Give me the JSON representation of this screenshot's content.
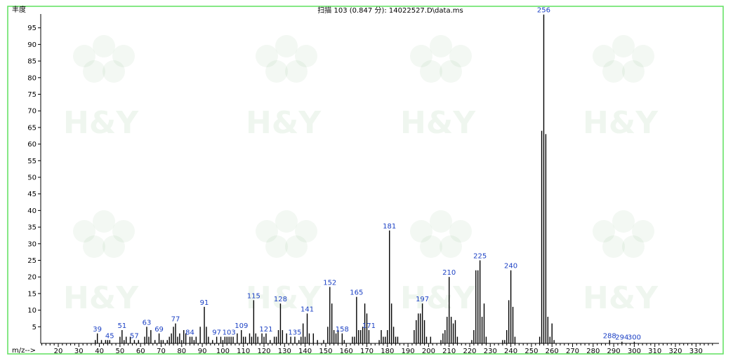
{
  "chart_data": {
    "type": "bar",
    "title": "扫描 103 (0.847 分): 14022527.D\\data.ms",
    "ylabel": "丰度",
    "xlabel": "m/z-->",
    "xlim": [
      10,
      340
    ],
    "ylim": [
      0,
      100
    ],
    "x_ticks": [
      20,
      30,
      40,
      50,
      60,
      70,
      80,
      90,
      100,
      110,
      120,
      130,
      140,
      150,
      160,
      170,
      180,
      190,
      200,
      210,
      220,
      230,
      240,
      250,
      260,
      270,
      280,
      290,
      300,
      310,
      320,
      330
    ],
    "y_ticks": [
      5,
      10,
      15,
      20,
      25,
      30,
      35,
      40,
      45,
      50,
      55,
      60,
      65,
      70,
      75,
      80,
      85,
      90,
      95
    ],
    "peaks": [
      {
        "mz": 38,
        "y": 1
      },
      {
        "mz": 39,
        "y": 3
      },
      {
        "mz": 41,
        "y": 1
      },
      {
        "mz": 43,
        "y": 1
      },
      {
        "mz": 44,
        "y": 1
      },
      {
        "mz": 45,
        "y": 1
      },
      {
        "mz": 50,
        "y": 2
      },
      {
        "mz": 51,
        "y": 4
      },
      {
        "mz": 52,
        "y": 1
      },
      {
        "mz": 53,
        "y": 2
      },
      {
        "mz": 55,
        "y": 2
      },
      {
        "mz": 57,
        "y": 1
      },
      {
        "mz": 59,
        "y": 1
      },
      {
        "mz": 62,
        "y": 2
      },
      {
        "mz": 63,
        "y": 5
      },
      {
        "mz": 64,
        "y": 2
      },
      {
        "mz": 65,
        "y": 4
      },
      {
        "mz": 67,
        "y": 1
      },
      {
        "mz": 69,
        "y": 3
      },
      {
        "mz": 70,
        "y": 1
      },
      {
        "mz": 71,
        "y": 1
      },
      {
        "mz": 73,
        "y": 1
      },
      {
        "mz": 74,
        "y": 2
      },
      {
        "mz": 75,
        "y": 3
      },
      {
        "mz": 76,
        "y": 5
      },
      {
        "mz": 77,
        "y": 6
      },
      {
        "mz": 78,
        "y": 2
      },
      {
        "mz": 79,
        "y": 3
      },
      {
        "mz": 80,
        "y": 1
      },
      {
        "mz": 81,
        "y": 4
      },
      {
        "mz": 82,
        "y": 3
      },
      {
        "mz": 84,
        "y": 2
      },
      {
        "mz": 85,
        "y": 2
      },
      {
        "mz": 86,
        "y": 1
      },
      {
        "mz": 87,
        "y": 2
      },
      {
        "mz": 89,
        "y": 5
      },
      {
        "mz": 91,
        "y": 11
      },
      {
        "mz": 92,
        "y": 5
      },
      {
        "mz": 93,
        "y": 2
      },
      {
        "mz": 95,
        "y": 1
      },
      {
        "mz": 97,
        "y": 2
      },
      {
        "mz": 99,
        "y": 2
      },
      {
        "mz": 100,
        "y": 1
      },
      {
        "mz": 101,
        "y": 2
      },
      {
        "mz": 102,
        "y": 2
      },
      {
        "mz": 103,
        "y": 2
      },
      {
        "mz": 104,
        "y": 2
      },
      {
        "mz": 105,
        "y": 2
      },
      {
        "mz": 107,
        "y": 3
      },
      {
        "mz": 109,
        "y": 4
      },
      {
        "mz": 110,
        "y": 2
      },
      {
        "mz": 111,
        "y": 2
      },
      {
        "mz": 113,
        "y": 3
      },
      {
        "mz": 114,
        "y": 2
      },
      {
        "mz": 115,
        "y": 13
      },
      {
        "mz": 116,
        "y": 3
      },
      {
        "mz": 117,
        "y": 2
      },
      {
        "mz": 119,
        "y": 3
      },
      {
        "mz": 120,
        "y": 2
      },
      {
        "mz": 121,
        "y": 3
      },
      {
        "mz": 123,
        "y": 1
      },
      {
        "mz": 125,
        "y": 2
      },
      {
        "mz": 126,
        "y": 2
      },
      {
        "mz": 127,
        "y": 4
      },
      {
        "mz": 128,
        "y": 12
      },
      {
        "mz": 129,
        "y": 4
      },
      {
        "mz": 131,
        "y": 3
      },
      {
        "mz": 133,
        "y": 2
      },
      {
        "mz": 135,
        "y": 2
      },
      {
        "mz": 137,
        "y": 1
      },
      {
        "mz": 138,
        "y": 2
      },
      {
        "mz": 139,
        "y": 6
      },
      {
        "mz": 140,
        "y": 2
      },
      {
        "mz": 141,
        "y": 9
      },
      {
        "mz": 142,
        "y": 3
      },
      {
        "mz": 144,
        "y": 3
      },
      {
        "mz": 146,
        "y": 1
      },
      {
        "mz": 149,
        "y": 1
      },
      {
        "mz": 151,
        "y": 5
      },
      {
        "mz": 152,
        "y": 17
      },
      {
        "mz": 153,
        "y": 12
      },
      {
        "mz": 154,
        "y": 4
      },
      {
        "mz": 155,
        "y": 3
      },
      {
        "mz": 156,
        "y": 4
      },
      {
        "mz": 158,
        "y": 3
      },
      {
        "mz": 159,
        "y": 1
      },
      {
        "mz": 163,
        "y": 2
      },
      {
        "mz": 164,
        "y": 2
      },
      {
        "mz": 165,
        "y": 14
      },
      {
        "mz": 166,
        "y": 4
      },
      {
        "mz": 167,
        "y": 4
      },
      {
        "mz": 168,
        "y": 5
      },
      {
        "mz": 169,
        "y": 12
      },
      {
        "mz": 170,
        "y": 9
      },
      {
        "mz": 171,
        "y": 4
      },
      {
        "mz": 176,
        "y": 1
      },
      {
        "mz": 177,
        "y": 4
      },
      {
        "mz": 178,
        "y": 2
      },
      {
        "mz": 179,
        "y": 2
      },
      {
        "mz": 180,
        "y": 4
      },
      {
        "mz": 181,
        "y": 34
      },
      {
        "mz": 182,
        "y": 12
      },
      {
        "mz": 183,
        "y": 5
      },
      {
        "mz": 184,
        "y": 2
      },
      {
        "mz": 185,
        "y": 2
      },
      {
        "mz": 193,
        "y": 4
      },
      {
        "mz": 194,
        "y": 7
      },
      {
        "mz": 195,
        "y": 9
      },
      {
        "mz": 196,
        "y": 9
      },
      {
        "mz": 197,
        "y": 12
      },
      {
        "mz": 198,
        "y": 7
      },
      {
        "mz": 199,
        "y": 2
      },
      {
        "mz": 201,
        "y": 2
      },
      {
        "mz": 206,
        "y": 1
      },
      {
        "mz": 207,
        "y": 3
      },
      {
        "mz": 208,
        "y": 4
      },
      {
        "mz": 209,
        "y": 8
      },
      {
        "mz": 210,
        "y": 20
      },
      {
        "mz": 211,
        "y": 8
      },
      {
        "mz": 212,
        "y": 6
      },
      {
        "mz": 213,
        "y": 7
      },
      {
        "mz": 214,
        "y": 2
      },
      {
        "mz": 221,
        "y": 1
      },
      {
        "mz": 222,
        "y": 4
      },
      {
        "mz": 223,
        "y": 22
      },
      {
        "mz": 224,
        "y": 22
      },
      {
        "mz": 225,
        "y": 25
      },
      {
        "mz": 226,
        "y": 8
      },
      {
        "mz": 227,
        "y": 12
      },
      {
        "mz": 228,
        "y": 2
      },
      {
        "mz": 236,
        "y": 1
      },
      {
        "mz": 237,
        "y": 1
      },
      {
        "mz": 238,
        "y": 4
      },
      {
        "mz": 239,
        "y": 13
      },
      {
        "mz": 240,
        "y": 22
      },
      {
        "mz": 241,
        "y": 11
      },
      {
        "mz": 242,
        "y": 2
      },
      {
        "mz": 254,
        "y": 2
      },
      {
        "mz": 255,
        "y": 64
      },
      {
        "mz": 256,
        "y": 99
      },
      {
        "mz": 257,
        "y": 63
      },
      {
        "mz": 258,
        "y": 8
      },
      {
        "mz": 259,
        "y": 2
      },
      {
        "mz": 260,
        "y": 6
      },
      {
        "mz": 261,
        "y": 1
      },
      {
        "mz": 288,
        "y": 1
      },
      {
        "mz": 294,
        "y": 0.5
      },
      {
        "mz": 300,
        "y": 0.5
      }
    ],
    "labels": [
      39,
      45,
      51,
      57,
      63,
      69,
      77,
      84,
      91,
      97,
      103,
      109,
      115,
      121,
      128,
      135,
      141,
      152,
      158,
      165,
      171,
      181,
      197,
      210,
      225,
      240,
      256,
      288,
      294,
      300
    ]
  },
  "watermark": {
    "text": "H&Y",
    "color": "#2f8a2f"
  }
}
